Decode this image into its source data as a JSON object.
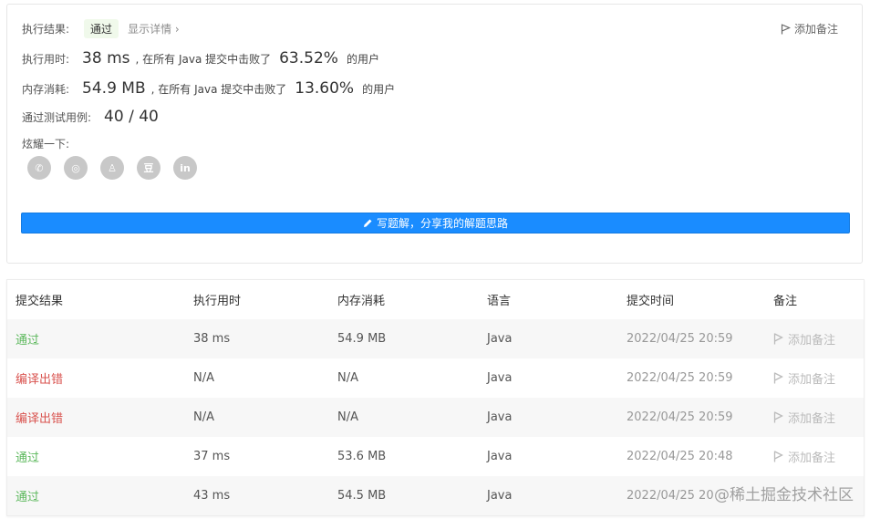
{
  "summary": {
    "result_label": "执行结果:",
    "result_badge": "通过",
    "detail_link": "显示详情 ›",
    "add_note": "添加备注",
    "runtime_label": "执行用时:",
    "runtime_value": "38 ms",
    "runtime_prefix": ", 在所有 Java 提交中击败了",
    "runtime_percent": "63.52%",
    "runtime_suffix": "的用户",
    "memory_label": "内存消耗:",
    "memory_value": "54.9 MB",
    "memory_prefix": ", 在所有 Java 提交中击败了",
    "memory_percent": "13.60%",
    "memory_suffix": "的用户",
    "tests_label": "通过测试用例:",
    "tests_value": "40 / 40",
    "share_label": "炫耀一下:",
    "share_icons": [
      "wechat-icon",
      "weibo-icon",
      "qq-icon",
      "douban-icon",
      "linkedin-icon"
    ],
    "share_glyphs": [
      "✆",
      "◎",
      "♙",
      "豆",
      "in"
    ],
    "write_button": "写题解，分享我的解题思路"
  },
  "table": {
    "headers": [
      "提交结果",
      "执行用时",
      "内存消耗",
      "语言",
      "提交时间",
      "备注"
    ],
    "rows": [
      {
        "result": "通过",
        "status": "pass",
        "runtime": "38 ms",
        "memory": "54.9 MB",
        "lang": "Java",
        "time": "2022/04/25 20:59",
        "note": "添加备注"
      },
      {
        "result": "编译出错",
        "status": "error",
        "runtime": "N/A",
        "memory": "N/A",
        "lang": "Java",
        "time": "2022/04/25 20:59",
        "note": "添加备注"
      },
      {
        "result": "编译出错",
        "status": "error",
        "runtime": "N/A",
        "memory": "N/A",
        "lang": "Java",
        "time": "2022/04/25 20:59",
        "note": "添加备注"
      },
      {
        "result": "通过",
        "status": "pass",
        "runtime": "37 ms",
        "memory": "53.6 MB",
        "lang": "Java",
        "time": "2022/04/25 20:48",
        "note": "添加备注"
      },
      {
        "result": "通过",
        "status": "pass",
        "runtime": "43 ms",
        "memory": "54.5 MB",
        "lang": "Java",
        "time": "2022/04/25 20",
        "note": "添加备注"
      }
    ]
  },
  "watermark": "@稀土掘金技术社区",
  "colors": {
    "accent": "#1a8cff",
    "pass": "#5cb85c",
    "error": "#d9534f"
  }
}
